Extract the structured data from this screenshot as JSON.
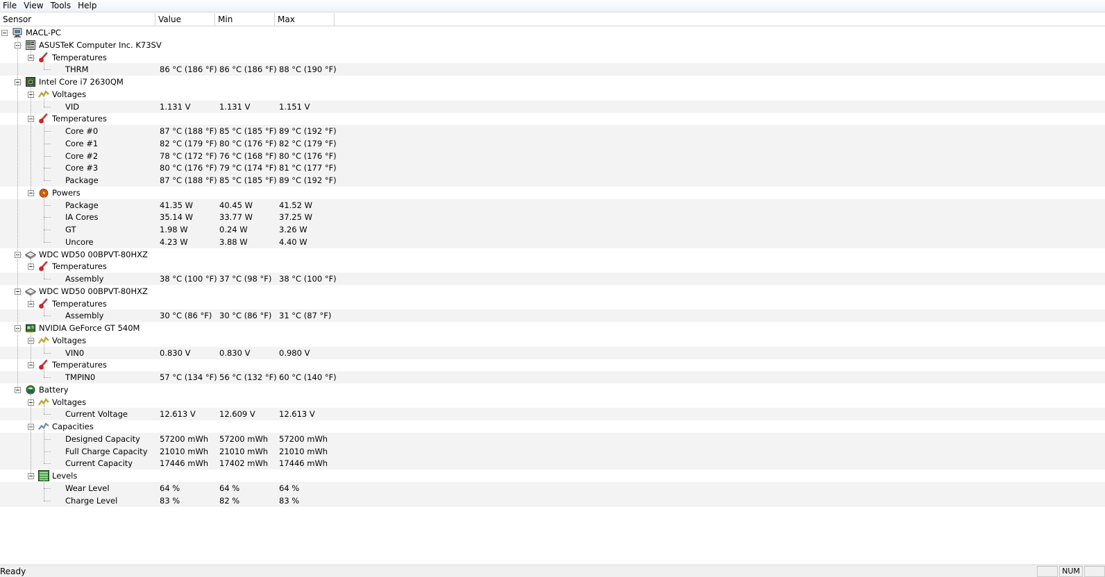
{
  "menu": [
    "File",
    "View",
    "Tools",
    "Help"
  ],
  "columns": [
    "Sensor",
    "Value",
    "Min",
    "Max"
  ],
  "status": {
    "text": "Ready",
    "panel_num": "NUM"
  },
  "rows": [
    {
      "level": 0,
      "label": "MACL-PC",
      "icon": "computer-icon"
    },
    {
      "level": 1,
      "label": "ASUSTeK Computer Inc. K73SV",
      "icon": "motherboard-icon"
    },
    {
      "level": 2,
      "label": "Temperatures",
      "icon": "thermometer-icon"
    },
    {
      "level": 3,
      "label": "THRM",
      "value": "86 °C  (186 °F)",
      "min": "86 °C  (186 °F)",
      "max": "88 °C  (190 °F)"
    },
    {
      "level": 1,
      "label": "Intel Core i7 2630QM",
      "icon": "cpu-icon"
    },
    {
      "level": 2,
      "label": "Voltages",
      "icon": "voltage-icon"
    },
    {
      "level": 3,
      "label": "VID",
      "value": "1.131 V",
      "min": "1.131 V",
      "max": "1.151 V"
    },
    {
      "level": 2,
      "label": "Temperatures",
      "icon": "thermometer-icon"
    },
    {
      "level": 3,
      "label": "Core #0",
      "value": "87 °C  (188 °F)",
      "min": "85 °C  (185 °F)",
      "max": "89 °C  (192 °F)"
    },
    {
      "level": 3,
      "label": "Core #1",
      "value": "82 °C  (179 °F)",
      "min": "80 °C  (176 °F)",
      "max": "82 °C  (179 °F)"
    },
    {
      "level": 3,
      "label": "Core #2",
      "value": "78 °C  (172 °F)",
      "min": "76 °C  (168 °F)",
      "max": "80 °C  (176 °F)"
    },
    {
      "level": 3,
      "label": "Core #3",
      "value": "80 °C  (176 °F)",
      "min": "79 °C  (174 °F)",
      "max": "81 °C  (177 °F)"
    },
    {
      "level": 3,
      "label": "Package",
      "value": "87 °C  (188 °F)",
      "min": "85 °C  (185 °F)",
      "max": "89 °C  (192 °F)"
    },
    {
      "level": 2,
      "label": "Powers",
      "icon": "power-icon"
    },
    {
      "level": 3,
      "label": "Package",
      "value": "41.35 W",
      "min": "40.45 W",
      "max": "41.52 W"
    },
    {
      "level": 3,
      "label": "IA Cores",
      "value": "35.14 W",
      "min": "33.77 W",
      "max": "37.25 W"
    },
    {
      "level": 3,
      "label": "GT",
      "value": "1.98 W",
      "min": "0.24 W",
      "max": "3.26 W"
    },
    {
      "level": 3,
      "label": "Uncore",
      "value": "4.23 W",
      "min": "3.88 W",
      "max": "4.40 W"
    },
    {
      "level": 1,
      "label": "WDC WD50 00BPVT-80HXZ",
      "icon": "hard-drive-icon"
    },
    {
      "level": 2,
      "label": "Temperatures",
      "icon": "thermometer-icon"
    },
    {
      "level": 3,
      "label": "Assembly",
      "value": "38 °C  (100 °F)",
      "min": "37 °C  (98 °F)",
      "max": "38 °C  (100 °F)"
    },
    {
      "level": 1,
      "label": "WDC WD50 00BPVT-80HXZ",
      "icon": "hard-drive-icon"
    },
    {
      "level": 2,
      "label": "Temperatures",
      "icon": "thermometer-icon"
    },
    {
      "level": 3,
      "label": "Assembly",
      "value": "30 °C  (86 °F)",
      "min": "30 °C  (86 °F)",
      "max": "31 °C  (87 °F)"
    },
    {
      "level": 1,
      "label": "NVIDIA GeForce GT 540M",
      "icon": "gpu-icon"
    },
    {
      "level": 2,
      "label": "Voltages",
      "icon": "voltage-icon"
    },
    {
      "level": 3,
      "label": "VIN0",
      "value": "0.830 V",
      "min": "0.830 V",
      "max": "0.980 V"
    },
    {
      "level": 2,
      "label": "Temperatures",
      "icon": "thermometer-icon"
    },
    {
      "level": 3,
      "label": "TMPIN0",
      "value": "57 °C  (134 °F)",
      "min": "56 °C  (132 °F)",
      "max": "60 °C  (140 °F)"
    },
    {
      "level": 1,
      "label": "Battery",
      "icon": "battery-icon"
    },
    {
      "level": 2,
      "label": "Voltages",
      "icon": "voltage-icon"
    },
    {
      "level": 3,
      "label": "Current Voltage",
      "value": "12.613 V",
      "min": "12.609 V",
      "max": "12.613 V"
    },
    {
      "level": 2,
      "label": "Capacities",
      "icon": "capacity-icon"
    },
    {
      "level": 3,
      "label": "Designed Capacity",
      "value": "57200 mWh",
      "min": "57200 mWh",
      "max": "57200 mWh"
    },
    {
      "level": 3,
      "label": "Full Charge Capacity",
      "value": "21010 mWh",
      "min": "21010 mWh",
      "max": "21010 mWh"
    },
    {
      "level": 3,
      "label": "Current Capacity",
      "value": "17446 mWh",
      "min": "17402 mWh",
      "max": "17446 mWh"
    },
    {
      "level": 2,
      "label": "Levels",
      "icon": "levels-icon"
    },
    {
      "level": 3,
      "label": "Wear Level",
      "value": "64 %",
      "min": "64 %",
      "max": "64 %"
    },
    {
      "level": 3,
      "label": "Charge Level",
      "value": "83 %",
      "min": "82 %",
      "max": "83 %"
    }
  ]
}
